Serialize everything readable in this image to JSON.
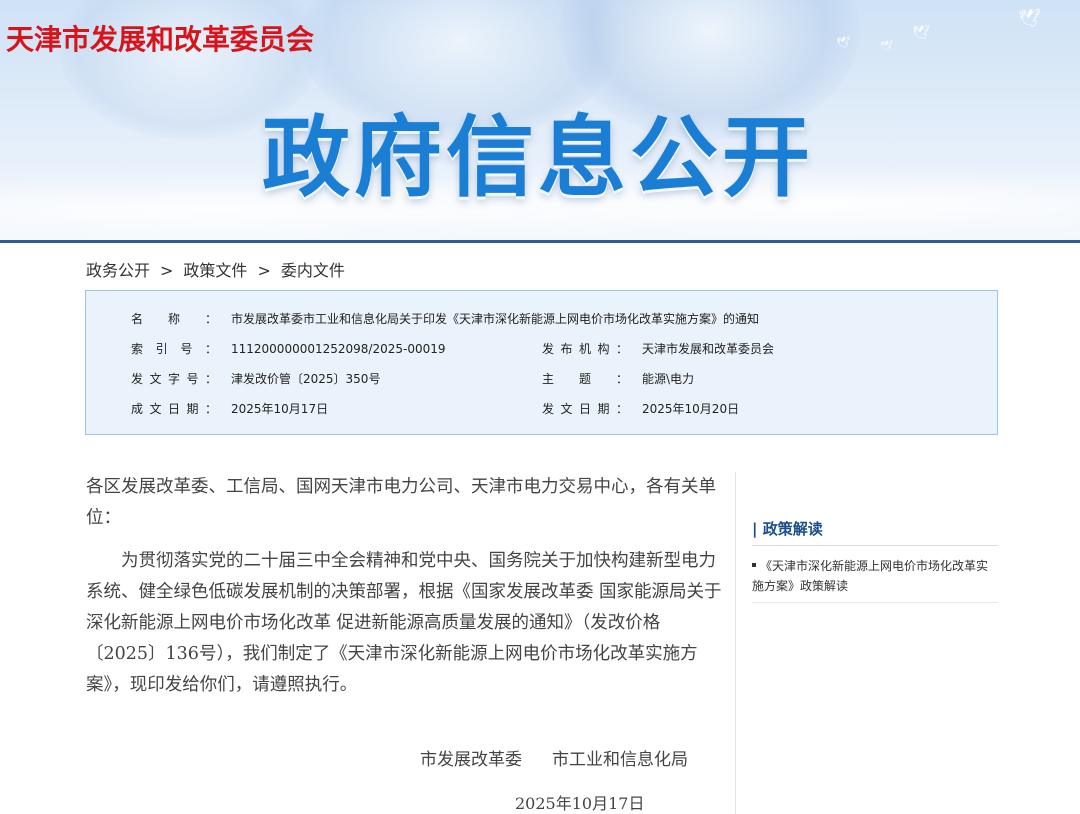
{
  "header": {
    "site_name": "天津市发展和改革委员会",
    "banner_title": "政府信息公开"
  },
  "breadcrumb": {
    "items": [
      "政务公开",
      "政策文件",
      "委内文件"
    ],
    "separator": ">"
  },
  "meta": {
    "name_label": "名称：",
    "name_value": "市发展改革委市工业和信息化局关于印发《天津市深化新能源上网电价市场化改革实施方案》的通知",
    "index_label": "索引号：",
    "index_value": "111200000001252098/2025-00019",
    "org_label": "发布机构：",
    "org_value": "天津市发展和改革委员会",
    "docno_label": "发文字号：",
    "docno_value": "津发改价管〔2025〕350号",
    "topic_label": "主题：",
    "topic_value": "能源\\电力",
    "created_label": "成文日期：",
    "created_value": "2025年10月17日",
    "issued_label": "发文日期：",
    "issued_value": "2025年10月20日"
  },
  "content": {
    "addressee": "各区发展改革委、工信局、国网天津市电力公司、天津市电力交易中心，各有关单位：",
    "body": "为贯彻落实党的二十届三中全会精神和党中央、国务院关于加快构建新型电力系统、健全绿色低碳发展机制的决策部署，根据《国家发展改革委 国家能源局关于深化新能源上网电价市场化改革 促进新能源高质量发展的通知》（发改价格〔2025〕136号），我们制定了《天津市深化新能源上网电价市场化改革实施方案》，现印发给你们，请遵照执行。",
    "signer1": "市发展改革委",
    "signer2": "市工业和信息化局",
    "sign_date": "2025年10月17日"
  },
  "sidebar": {
    "title": "| 政策解读",
    "item": "《天津市深化新能源上网电价市场化改革实施方案》政策解读"
  },
  "colors": {
    "site_name_red": "#d8141b",
    "banner_title_blue": "#1a7fd4",
    "meta_bg": "#eaf3fb",
    "meta_border": "#9cc4e6",
    "sidebar_title": "#1a4f8c"
  }
}
